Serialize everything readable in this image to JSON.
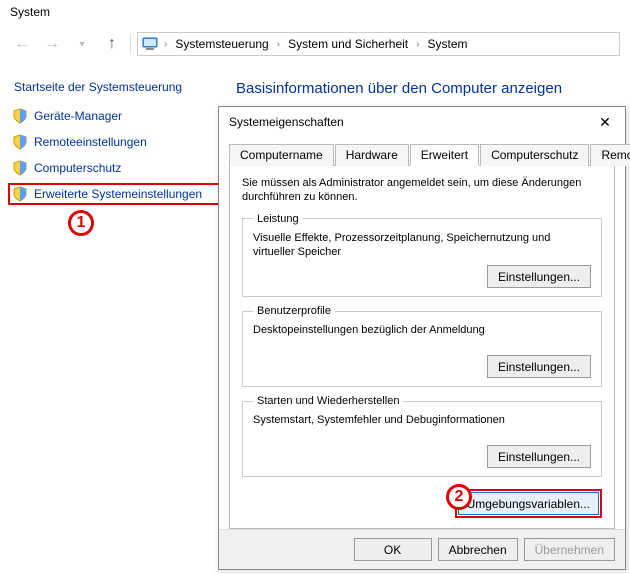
{
  "window": {
    "title": "System"
  },
  "toolbar": {
    "breadcrumb": [
      "Systemsteuerung",
      "System und Sicherheit",
      "System"
    ]
  },
  "sidebar": {
    "title": "Startseite der Systemsteuerung",
    "items": [
      {
        "label": "Geräte-Manager"
      },
      {
        "label": "Remoteeinstellungen"
      },
      {
        "label": "Computerschutz"
      },
      {
        "label": "Erweiterte Systemeinstellungen"
      }
    ]
  },
  "content": {
    "heading": "Basisinformationen über den Computer anzeigen"
  },
  "annotations": {
    "one": "1",
    "two": "2"
  },
  "dialog": {
    "title": "Systemeigenschaften",
    "close": "✕",
    "tabs": [
      {
        "label": "Computername"
      },
      {
        "label": "Hardware"
      },
      {
        "label": "Erweitert"
      },
      {
        "label": "Computerschutz"
      },
      {
        "label": "Remote"
      }
    ],
    "intro": "Sie müssen als Administrator angemeldet sein, um diese Änderungen durchführen zu können.",
    "groups": {
      "leistung": {
        "legend": "Leistung",
        "desc": "Visuelle Effekte, Prozessorzeitplanung, Speichernutzung und virtueller Speicher",
        "button": "Einstellungen..."
      },
      "profile": {
        "legend": "Benutzerprofile",
        "desc": "Desktopeinstellungen bezüglich der Anmeldung",
        "button": "Einstellungen..."
      },
      "start": {
        "legend": "Starten und Wiederherstellen",
        "desc": "Systemstart, Systemfehler und Debuginformationen",
        "button": "Einstellungen..."
      }
    },
    "env_button": "Umgebungsvariablen...",
    "footer": {
      "ok": "OK",
      "cancel": "Abbrechen",
      "apply": "Übernehmen"
    }
  }
}
